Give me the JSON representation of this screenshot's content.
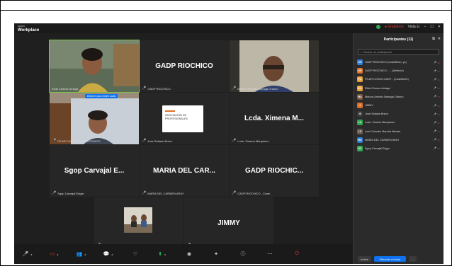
{
  "app": {
    "brand_small": "zoom",
    "brand_big": "Workplace"
  },
  "titlebar": {
    "recording": "Grabando",
    "view": "Vista",
    "minimize": "–",
    "maximize": "☐",
    "close": "✕"
  },
  "tiles": [
    {
      "id": "t1",
      "big_name": "",
      "label": "Elida Chavez Arriaga",
      "muted": false
    },
    {
      "id": "t2",
      "big_name": "GADP RIOCHICO",
      "label": "GADP RIOCHICO",
      "muted": true
    },
    {
      "id": "t3",
      "big_name": "",
      "label": "Marcos Antonio Barraga Ordono",
      "muted": true
    },
    {
      "id": "t4",
      "big_name": "",
      "label": "PILAR CHOEZ GAD PRIOCHICO",
      "muted": true
    },
    {
      "id": "t5",
      "big_name": "",
      "label": "Jose Salazar Bravo",
      "muted": true
    },
    {
      "id": "t6",
      "big_name": "Lcda. Ximena M...",
      "label": "Lcda. Ximena Marquinez",
      "muted": true
    },
    {
      "id": "t7",
      "big_name": "Sgop Carvajal E...",
      "label": "Sgop Carvajal Edgar",
      "muted": true
    },
    {
      "id": "t8",
      "big_name": "MARIA DEL CAR...",
      "label": "MARIA DEL CARMEN ARAY",
      "muted": true
    },
    {
      "id": "t9",
      "big_name": "GADP RIOCHIC...",
      "label": "GADP RIOCHICO - Zoom",
      "muted": true
    },
    {
      "id": "t10",
      "big_name": "",
      "label": "Luis Colombo Moreira Macias",
      "muted": true
    },
    {
      "id": "t11",
      "big_name": "JIMMY",
      "label": "JIMMY",
      "muted": true
    }
  ],
  "t4_banner": "Detener para recibir audio",
  "t5_logo": "ASOCIACIÓN DE PROFESIONALES",
  "sidebar": {
    "title": "Participantes (11)",
    "search_placeholder": "Buscar un participante",
    "participants": [
      {
        "initials": "GR",
        "color": "#2f7dd3",
        "name": "GADP RIOCHICO (Coanfitrión, yo)"
      },
      {
        "initials": "GR",
        "color": "#e0712b",
        "name": "GADP RIOCHICO - ... (Anfitrión)"
      },
      {
        "initials": "PC",
        "color": "#e8a33b",
        "name": "PILAR CHOEZ GADP... (Coanfitrión)"
      },
      {
        "initials": "EC",
        "color": "#e8a33b",
        "name": "Elida Chavez Arriaga"
      },
      {
        "initials": "MA",
        "color": "#7a5a44",
        "name": "Marcos Antonio Barraga Ordono"
      },
      {
        "initials": "J",
        "color": "#e0712b",
        "name": "JIMMY"
      },
      {
        "initials": "JS",
        "color": "#3a3a3a",
        "name": "Jose Salazar Bravo"
      },
      {
        "initials": "LX",
        "color": "#2fa84f",
        "name": "Lcda. Ximena Marquinez"
      },
      {
        "initials": "LC",
        "color": "#6b5a50",
        "name": "Luis Colombo Moreira Macias"
      },
      {
        "initials": "MD",
        "color": "#2f7dd3",
        "name": "MARIA DEL CARMEN ARAY"
      },
      {
        "initials": "SC",
        "color": "#2fa84f",
        "name": "Sgop Carvajal Edgar"
      }
    ],
    "invite": "Invitar",
    "mute_all": "Silenciar a todos",
    "more": "..."
  }
}
